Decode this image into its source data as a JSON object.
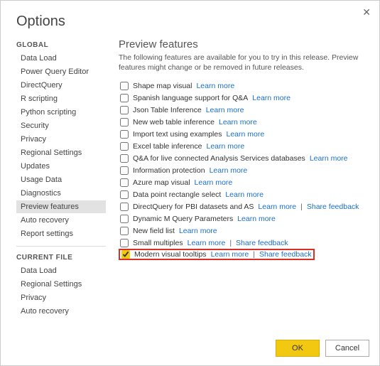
{
  "window": {
    "title": "Options",
    "close_glyph": "✕"
  },
  "sidebar": {
    "sections": [
      {
        "header": "GLOBAL",
        "items": [
          {
            "label": "Data Load",
            "selected": false
          },
          {
            "label": "Power Query Editor",
            "selected": false
          },
          {
            "label": "DirectQuery",
            "selected": false
          },
          {
            "label": "R scripting",
            "selected": false
          },
          {
            "label": "Python scripting",
            "selected": false
          },
          {
            "label": "Security",
            "selected": false
          },
          {
            "label": "Privacy",
            "selected": false
          },
          {
            "label": "Regional Settings",
            "selected": false
          },
          {
            "label": "Updates",
            "selected": false
          },
          {
            "label": "Usage Data",
            "selected": false
          },
          {
            "label": "Diagnostics",
            "selected": false
          },
          {
            "label": "Preview features",
            "selected": true
          },
          {
            "label": "Auto recovery",
            "selected": false
          },
          {
            "label": "Report settings",
            "selected": false
          }
        ]
      },
      {
        "header": "CURRENT FILE",
        "items": [
          {
            "label": "Data Load",
            "selected": false
          },
          {
            "label": "Regional Settings",
            "selected": false
          },
          {
            "label": "Privacy",
            "selected": false
          },
          {
            "label": "Auto recovery",
            "selected": false
          }
        ]
      }
    ]
  },
  "main": {
    "heading": "Preview features",
    "description": "The following features are available for you to try in this release. Preview features might change or be removed in future releases.",
    "learn_more": "Learn more",
    "share_feedback": "Share feedback",
    "features": [
      {
        "label": "Shape map visual",
        "checked": false,
        "learn": true,
        "share": false
      },
      {
        "label": "Spanish language support for Q&A",
        "checked": false,
        "learn": true,
        "share": false
      },
      {
        "label": "Json Table Inference",
        "checked": false,
        "learn": true,
        "share": false
      },
      {
        "label": "New web table inference",
        "checked": false,
        "learn": true,
        "share": false
      },
      {
        "label": "Import text using examples",
        "checked": false,
        "learn": true,
        "share": false
      },
      {
        "label": "Excel table inference",
        "checked": false,
        "learn": true,
        "share": false
      },
      {
        "label": "Q&A for live connected Analysis Services databases",
        "checked": false,
        "learn": true,
        "share": false
      },
      {
        "label": "Information protection",
        "checked": false,
        "learn": true,
        "share": false
      },
      {
        "label": "Azure map visual",
        "checked": false,
        "learn": true,
        "share": false
      },
      {
        "label": "Data point rectangle select",
        "checked": false,
        "learn": true,
        "share": false
      },
      {
        "label": "DirectQuery for PBI datasets and AS",
        "checked": false,
        "learn": true,
        "share": true
      },
      {
        "label": "Dynamic M Query Parameters",
        "checked": false,
        "learn": true,
        "share": false
      },
      {
        "label": "New field list",
        "checked": false,
        "learn": true,
        "share": false
      },
      {
        "label": "Small multiples",
        "checked": false,
        "learn": true,
        "share": true
      },
      {
        "label": "Modern visual tooltips",
        "checked": true,
        "learn": true,
        "share": true,
        "highlight": true
      }
    ]
  },
  "footer": {
    "ok": "OK",
    "cancel": "Cancel"
  }
}
